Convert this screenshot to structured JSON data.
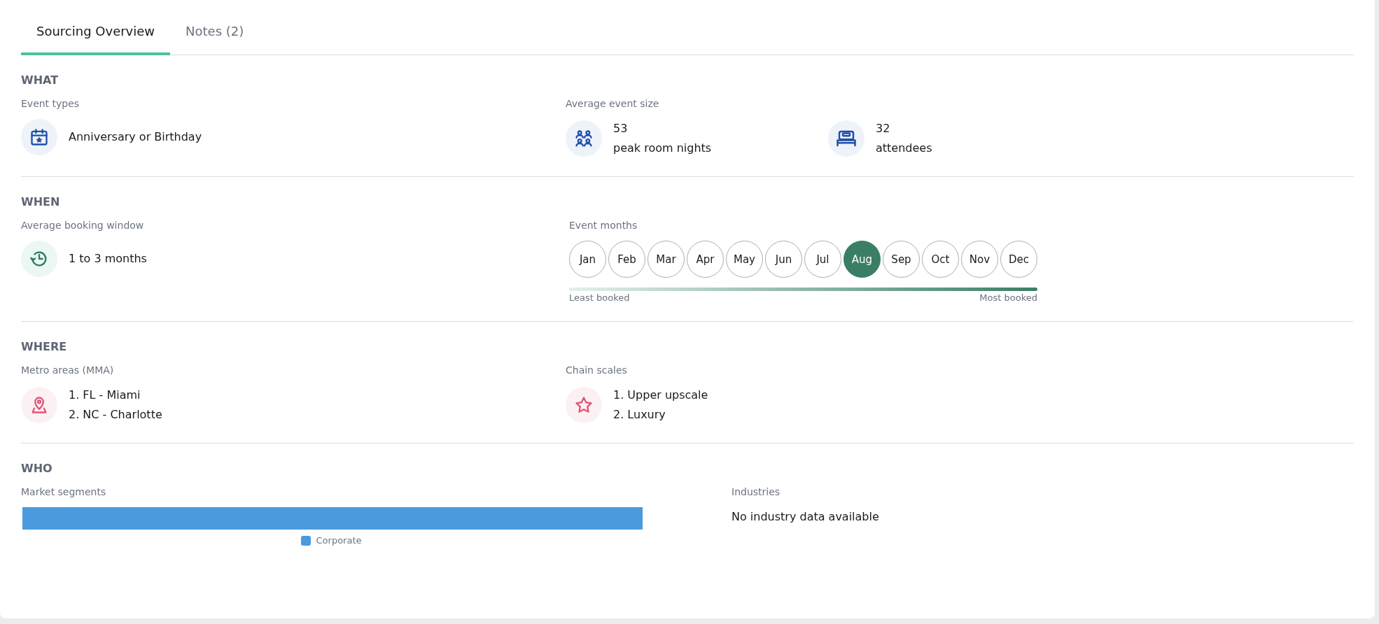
{
  "tabs": [
    {
      "label": "Sourcing Overview",
      "selected": true
    },
    {
      "label": "Notes (2)",
      "selected": false
    }
  ],
  "sections": [
    {
      "title": "WHAT",
      "kind": "what",
      "event_types": {
        "label": "Event types",
        "value": "Anniversary or Birthday"
      },
      "event_size": {
        "label": "Average event size",
        "metrics": [
          {
            "kind": "people",
            "value": "53",
            "unit": "peak room nights"
          },
          {
            "kind": "bed",
            "value": "32",
            "unit": "attendees"
          }
        ]
      }
    },
    {
      "title": "WHEN",
      "kind": "when",
      "booking_window": {
        "label": "Average booking window",
        "value": "1 to 3 months"
      },
      "event_months": {
        "label": "Event months",
        "months": [
          {
            "label": "Jan",
            "selected": false
          },
          {
            "label": "Feb",
            "selected": false
          },
          {
            "label": "Mar",
            "selected": false
          },
          {
            "label": "Apr",
            "selected": false
          },
          {
            "label": "May",
            "selected": false
          },
          {
            "label": "Jun",
            "selected": false
          },
          {
            "label": "Jul",
            "selected": false
          },
          {
            "label": "Aug",
            "selected": true
          },
          {
            "label": "Sep",
            "selected": false
          },
          {
            "label": "Oct",
            "selected": false
          },
          {
            "label": "Nov",
            "selected": false
          },
          {
            "label": "Dec",
            "selected": false
          }
        ],
        "scale_min": "Least booked",
        "scale_max": "Most booked"
      }
    },
    {
      "title": "WHERE",
      "kind": "where",
      "metro_areas": {
        "label": "Metro areas (MMA)",
        "items": [
          "1. FL - Miami",
          "2. NC - Charlotte"
        ]
      },
      "chain_scales": {
        "label": "Chain scales",
        "items": [
          "1. Upper upscale",
          "2. Luxury"
        ]
      }
    },
    {
      "title": "WHO",
      "kind": "who",
      "market_segments": {
        "label": "Market segments",
        "segments": [
          {
            "label": "Corporate",
            "color": "#4a9ade"
          }
        ]
      },
      "industries": {
        "label": "Industries",
        "value": "No industry data available"
      }
    }
  ]
}
